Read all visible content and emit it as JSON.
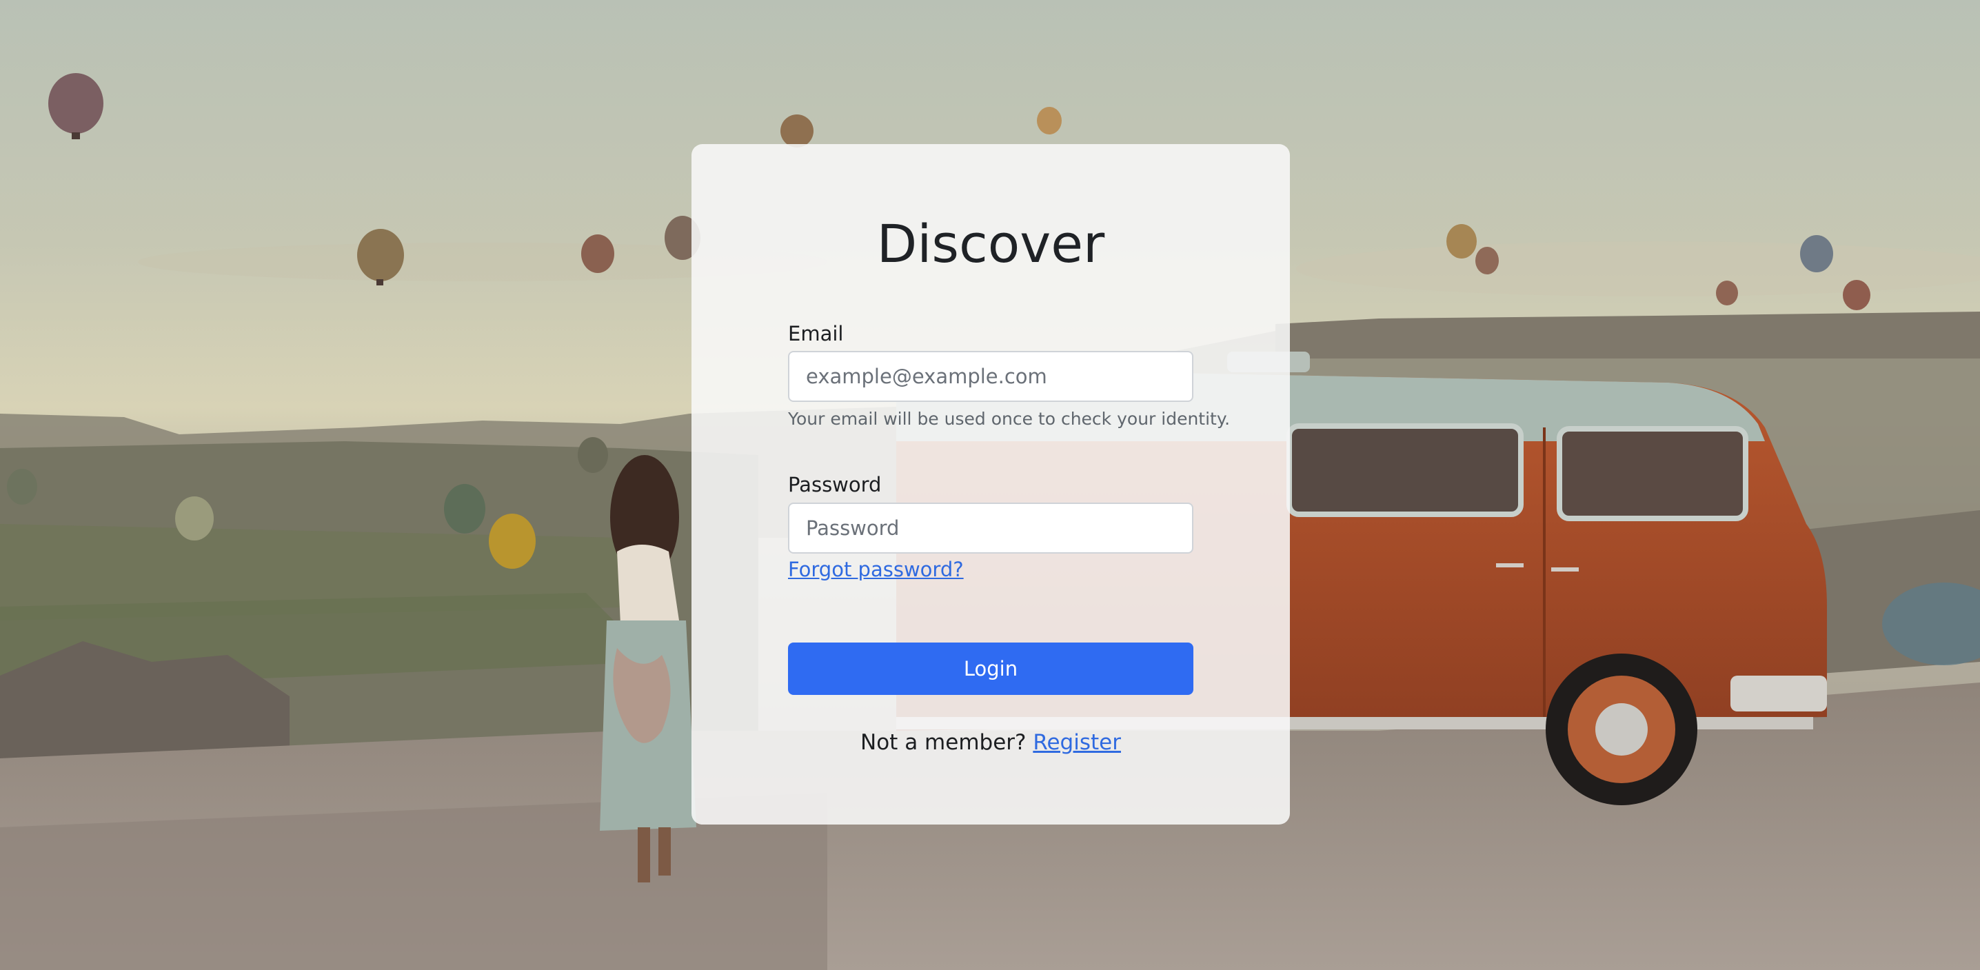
{
  "page": {
    "title": "Discover"
  },
  "email": {
    "label": "Email",
    "placeholder": "example@example.com",
    "value": "",
    "help_text": "Your email will be used once to check your identity."
  },
  "password": {
    "label": "Password",
    "placeholder": "Password",
    "value": ""
  },
  "links": {
    "forgot_password": "Forgot password?",
    "register": "Register"
  },
  "buttons": {
    "login": "Login"
  },
  "footer": {
    "prompt": "Not a member?"
  },
  "colors": {
    "accent": "#2f6bf2",
    "link": "#2f6ae0",
    "card_background": "#f8f8f8"
  }
}
